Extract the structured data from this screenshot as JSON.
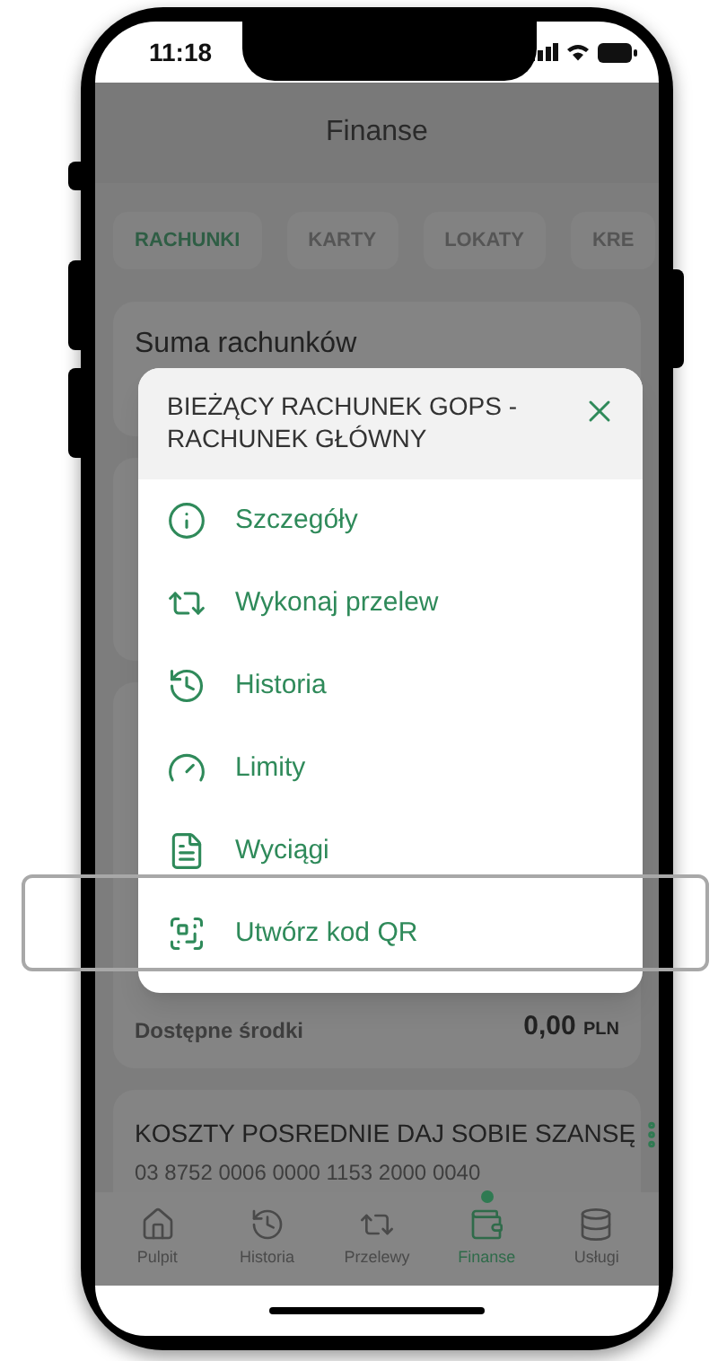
{
  "status_bar": {
    "time": "11:18"
  },
  "header": {
    "title": "Finanse"
  },
  "tabs": [
    {
      "label": "RACHUNKI",
      "selected": true
    },
    {
      "label": "KARTY",
      "selected": false
    },
    {
      "label": "LOKATY",
      "selected": false
    },
    {
      "label": "KRE",
      "selected": false
    }
  ],
  "summary_card": {
    "title": "Suma rachunków"
  },
  "account_card": {
    "available_label": "Dostępne środki",
    "available_amount": "0,00",
    "currency": "PLN"
  },
  "second_account": {
    "name": "KOSZTY POSREDNIE DAJ SOBIE SZANSĘ",
    "number": "03 8752 0006 0000 1153 2000 0040"
  },
  "modal": {
    "title": "BIEŻĄCY RACHUNEK GOPS - RACHUNEK GŁÓWNY",
    "items": [
      {
        "kind": "info",
        "label": "Szczegóły",
        "highlighted": false
      },
      {
        "kind": "transfer",
        "label": "Wykonaj przelew",
        "highlighted": false
      },
      {
        "kind": "history",
        "label": "Historia",
        "highlighted": false
      },
      {
        "kind": "limits",
        "label": "Limity",
        "highlighted": false
      },
      {
        "kind": "statements",
        "label": "Wyciągi",
        "highlighted": false
      },
      {
        "kind": "qr",
        "label": "Utwórz kod QR",
        "highlighted": true
      }
    ]
  },
  "bottom_nav": [
    {
      "kind": "home",
      "label": "Pulpit",
      "selected": false
    },
    {
      "kind": "history",
      "label": "Historia",
      "selected": false
    },
    {
      "kind": "transfer",
      "label": "Przelewy",
      "selected": false
    },
    {
      "kind": "wallet",
      "label": "Finanse",
      "selected": true
    },
    {
      "kind": "services",
      "label": "Usługi",
      "selected": false
    }
  ]
}
